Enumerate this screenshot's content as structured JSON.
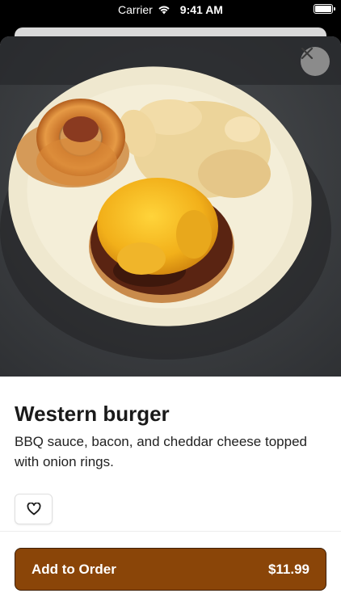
{
  "status_bar": {
    "carrier": "Carrier",
    "time": "9:41 AM"
  },
  "item": {
    "name": "Western burger",
    "description": "BBQ sauce, bacon, and cheddar cheese topped with onion rings."
  },
  "actions": {
    "close_icon": "close-icon",
    "favorite_icon": "heart-outline-icon",
    "add_to_order_label": "Add to Order",
    "price": "$11.99"
  },
  "colors": {
    "accent": "#8a4508",
    "accent_border": "#3d1e04"
  }
}
